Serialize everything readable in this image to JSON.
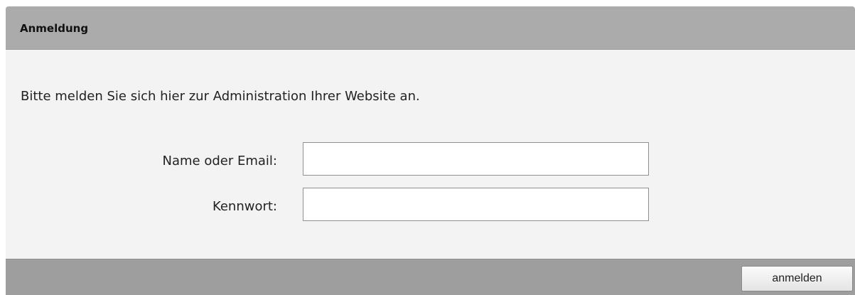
{
  "panel": {
    "title": "Anmeldung",
    "intro": "Bitte melden Sie sich hier zur Administration Ihrer Website an."
  },
  "form": {
    "name_label": "Name oder Email:",
    "name_value": "",
    "password_label": "Kennwort:",
    "password_value": ""
  },
  "footer": {
    "submit_label": "anmelden"
  },
  "colors": {
    "header": "#ababab",
    "body": "#f3f3f3",
    "footer": "#9e9e9e"
  }
}
